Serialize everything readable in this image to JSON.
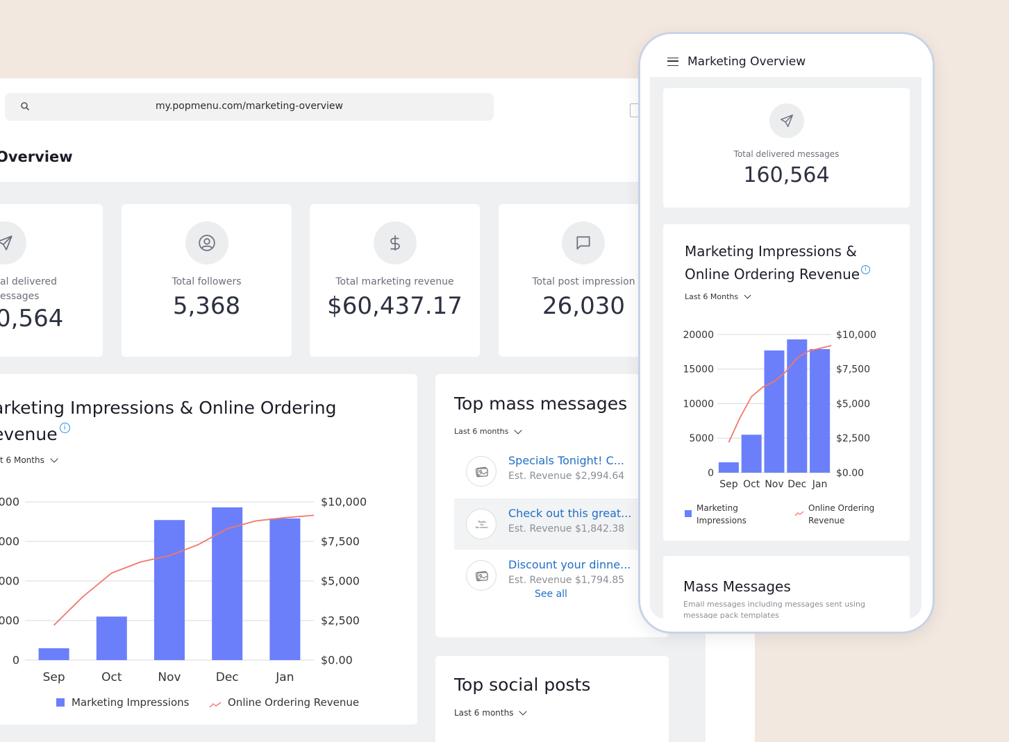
{
  "browser": {
    "url": "my.popmenu.com/marketing-overview",
    "page_title": "Overview"
  },
  "stats": [
    {
      "label_line1": "al delivered",
      "label_line2": "essages",
      "value": "0,564",
      "icon": "paper-plane-icon"
    },
    {
      "label": "Total followers",
      "value": "5,368",
      "icon": "user-circle-icon"
    },
    {
      "label": "Total marketing revenue",
      "value": "$60,437.17",
      "icon": "dollar-icon"
    },
    {
      "label": "Total post impression",
      "value": "26,030",
      "icon": "chat-bubble-icon"
    }
  ],
  "impressions_panel": {
    "title_line1": "arketing Impressions & Online Ordering",
    "title_line2": "evenue",
    "range": "t 6 Months"
  },
  "chart_data": [
    {
      "type": "bar",
      "categories": [
        "Sep",
        "Oct",
        "Nov",
        "Dec",
        "Jan"
      ],
      "series": [
        {
          "name": "Marketing Impressions",
          "type": "bar",
          "axis": "left",
          "values": [
            1500,
            5500,
            17700,
            19300,
            17900
          ]
        },
        {
          "name": "Online Ordering Revenue",
          "type": "line",
          "axis": "right",
          "x": [
            0,
            0.5,
            1,
            1.5,
            2,
            2.5,
            3,
            3.5,
            4,
            4.5
          ],
          "values": [
            2200,
            4000,
            5500,
            6200,
            6600,
            7300,
            8300,
            8800,
            9000,
            9150
          ]
        }
      ],
      "left_ticks": [
        "000",
        "000",
        "000",
        "000",
        "0"
      ],
      "left_ylim": [
        0,
        20000
      ],
      "right_ticks": [
        "$10,000",
        "$7,500",
        "$5,000",
        "$2,500",
        "$0.00"
      ],
      "right_ylim": [
        0,
        10000
      ],
      "legend": [
        "Marketing Impressions",
        "Online Ordering Revenue"
      ],
      "grid": true,
      "legend_position": "bottom"
    },
    {
      "type": "bar",
      "categories": [
        "Sep",
        "Oct",
        "Nov",
        "Dec",
        "Jan"
      ],
      "series": [
        {
          "name": "Marketing Impressions",
          "type": "bar",
          "axis": "left",
          "values": [
            1500,
            5500,
            17700,
            19300,
            17900
          ]
        },
        {
          "name": "Online Ordering Revenue",
          "type": "line",
          "axis": "right",
          "x": [
            0,
            0.5,
            1,
            1.5,
            2,
            2.5,
            3,
            3.5,
            4,
            4.5
          ],
          "values": [
            2200,
            4000,
            5500,
            6200,
            6600,
            7300,
            8300,
            8800,
            9000,
            9200
          ]
        }
      ],
      "left_ticks": [
        "20000",
        "15000",
        "10000",
        "5000",
        "0"
      ],
      "left_ylim": [
        0,
        20000
      ],
      "right_ticks": [
        "$10,000",
        "$7,500",
        "$5,000",
        "$2,500",
        "$0.00"
      ],
      "right_ylim": [
        0,
        10000
      ],
      "legend": [
        "Marketing Impressions",
        "Online Ordering Revenue"
      ],
      "grid": true,
      "legend_position": "bottom"
    }
  ],
  "top_mass": {
    "title": "Top mass messages",
    "range": "Last 6 months",
    "items": [
      {
        "title": "Specials Tonight! C...",
        "revenue": "Est. Revenue $2,994.64"
      },
      {
        "title": "Check out this great...",
        "revenue": "Est. Revenue $1,842.38"
      },
      {
        "title": "Discount your dinne...",
        "revenue": "Est. Revenue $1,794.85"
      }
    ],
    "see_all": "See all"
  },
  "top_social": {
    "title": "Top social posts",
    "range": "Last 6 months"
  },
  "phone": {
    "title": "Marketing Overview",
    "delivered_label": "Total delivered messages",
    "delivered_value": "160,564",
    "chart_title_line1": "Marketing Impressions &",
    "chart_title_line2": "Online Ordering Revenue",
    "range": "Last 6 Months",
    "legend_bar_line1": "Marketing",
    "legend_bar_line2": "Impressions",
    "legend_line_line1": "Online Ordering",
    "legend_line_line2": "Revenue",
    "mass_title": "Mass Messages",
    "mass_desc_line1": "Email messages including messages sent using",
    "mass_desc_line2": "message pack templates"
  },
  "colors": {
    "bar": "#6b7ffb",
    "line": "#f0786a",
    "link": "#1f6fc5",
    "info": "#2a8de0"
  }
}
